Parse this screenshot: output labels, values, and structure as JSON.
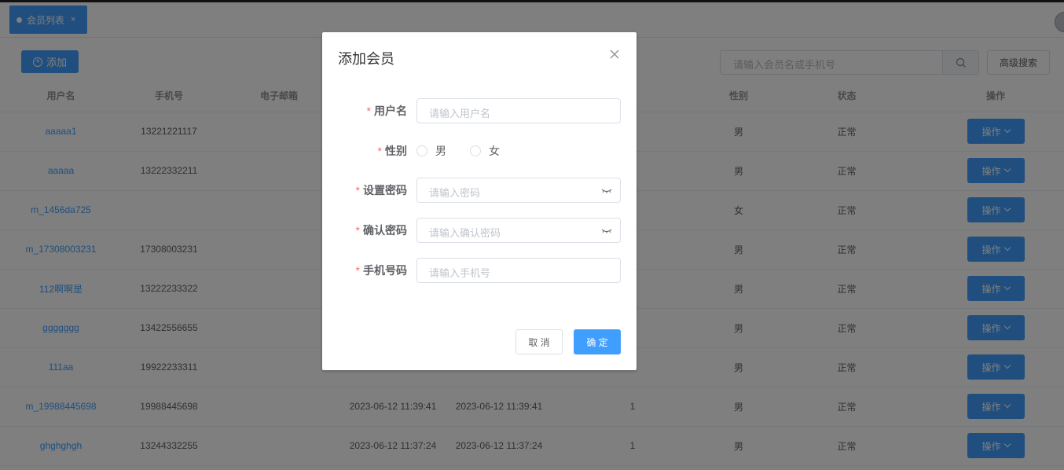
{
  "tab": {
    "label": "会员列表",
    "close": "×"
  },
  "toolbar": {
    "add_label": "添加",
    "search_placeholder": "请输入会员名或手机号",
    "advanced_label": "高级搜索"
  },
  "table": {
    "headers": [
      "用户名",
      "手机号",
      "电子邮箱",
      "",
      "",
      "",
      "性别",
      "状态",
      "操作"
    ],
    "rows": [
      {
        "user": "aaaaa1",
        "phone": "13221221117",
        "email": "",
        "created": "",
        "updated": "",
        "level": "",
        "gender": "男",
        "status": "正常",
        "op": "操作"
      },
      {
        "user": "aaaaa",
        "phone": "13222332211",
        "email": "",
        "created": "",
        "updated": "",
        "level": "",
        "gender": "男",
        "status": "正常",
        "op": "操作"
      },
      {
        "user": "m_1456da725",
        "phone": "",
        "email": "",
        "created": "",
        "updated": "",
        "level": "",
        "gender": "女",
        "status": "正常",
        "op": "操作"
      },
      {
        "user": "m_17308003231",
        "phone": "17308003231",
        "email": "",
        "created": "",
        "updated": "",
        "level": "",
        "gender": "男",
        "status": "正常",
        "op": "操作"
      },
      {
        "user": "112啊啊是",
        "phone": "13222233322",
        "email": "",
        "created": "",
        "updated": "",
        "level": "",
        "gender": "男",
        "status": "正常",
        "op": "操作"
      },
      {
        "user": "ggggggg",
        "phone": "13422556655",
        "email": "",
        "created": "",
        "updated": "",
        "level": "",
        "gender": "男",
        "status": "正常",
        "op": "操作"
      },
      {
        "user": "111aa",
        "phone": "19922233311",
        "email": "",
        "created": "",
        "updated": "",
        "level": "",
        "gender": "男",
        "status": "正常",
        "op": "操作"
      },
      {
        "user": "m_19988445698",
        "phone": "19988445698",
        "email": "",
        "created": "2023-06-12 11:39:41",
        "updated": "2023-06-12 11:39:41",
        "level": "1",
        "gender": "男",
        "status": "正常",
        "op": "操作"
      },
      {
        "user": "ghghghgh",
        "phone": "13244332255",
        "email": "",
        "created": "2023-06-12 11:37:24",
        "updated": "2023-06-12 11:37:24",
        "level": "1",
        "gender": "男",
        "status": "正常",
        "op": "操作"
      }
    ]
  },
  "dialog": {
    "title": "添加会员",
    "required_mark": "*",
    "username_label": "用户名",
    "username_placeholder": "请输入用户名",
    "gender_label": "性别",
    "gender_male": "男",
    "gender_female": "女",
    "password_label": "设置密码",
    "password_placeholder": "请输入密码",
    "confirm_label": "确认密码",
    "confirm_placeholder": "请输入确认密码",
    "phone_label": "手机号码",
    "phone_placeholder": "请输入手机号",
    "cancel_label": "取 消",
    "ok_label": "确 定"
  },
  "colors": {
    "primary": "#409eff",
    "required": "#f56c6c",
    "mask": "rgba(0,0,0,0.5)"
  }
}
